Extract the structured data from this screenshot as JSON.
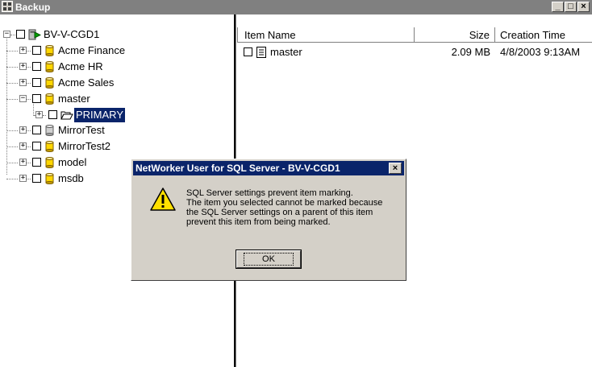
{
  "window": {
    "title": "Backup",
    "controls": {
      "minimize": "_",
      "maximize": "□",
      "close": "×"
    }
  },
  "tree": {
    "root_label": "BV-V-CGD1",
    "items": [
      {
        "label": "Acme Finance",
        "icon": "database-icon"
      },
      {
        "label": "Acme HR",
        "icon": "database-icon"
      },
      {
        "label": "Acme Sales",
        "icon": "database-icon"
      },
      {
        "label": "master",
        "icon": "database-icon",
        "expanded": true
      },
      {
        "label": "PRIMARY",
        "icon": "folder-open-icon",
        "selected": true
      },
      {
        "label": "MirrorTest",
        "icon": "database-icon"
      },
      {
        "label": "MirrorTest2",
        "icon": "database-icon"
      },
      {
        "label": "model",
        "icon": "database-icon"
      },
      {
        "label": "msdb",
        "icon": "database-icon"
      }
    ]
  },
  "list": {
    "columns": [
      "Item Name",
      "Size",
      "Creation Time"
    ],
    "rows": [
      {
        "name": "master",
        "size": "2.09 MB",
        "created": "4/8/2003 9:13AM"
      }
    ]
  },
  "dialog": {
    "title": "NetWorker User for SQL Server - BV-V-CGD1",
    "close": "×",
    "message_lines": [
      "SQL Server settings prevent item marking.",
      "The item you selected cannot be marked because",
      "the SQL Server settings on a parent of this item",
      "prevent this item from being marked."
    ],
    "ok_label": "OK"
  },
  "colors": {
    "selection": "#0a246a",
    "dialog_face": "#d4d0c8",
    "warning": "#ffe000",
    "database": "#c8a000"
  }
}
